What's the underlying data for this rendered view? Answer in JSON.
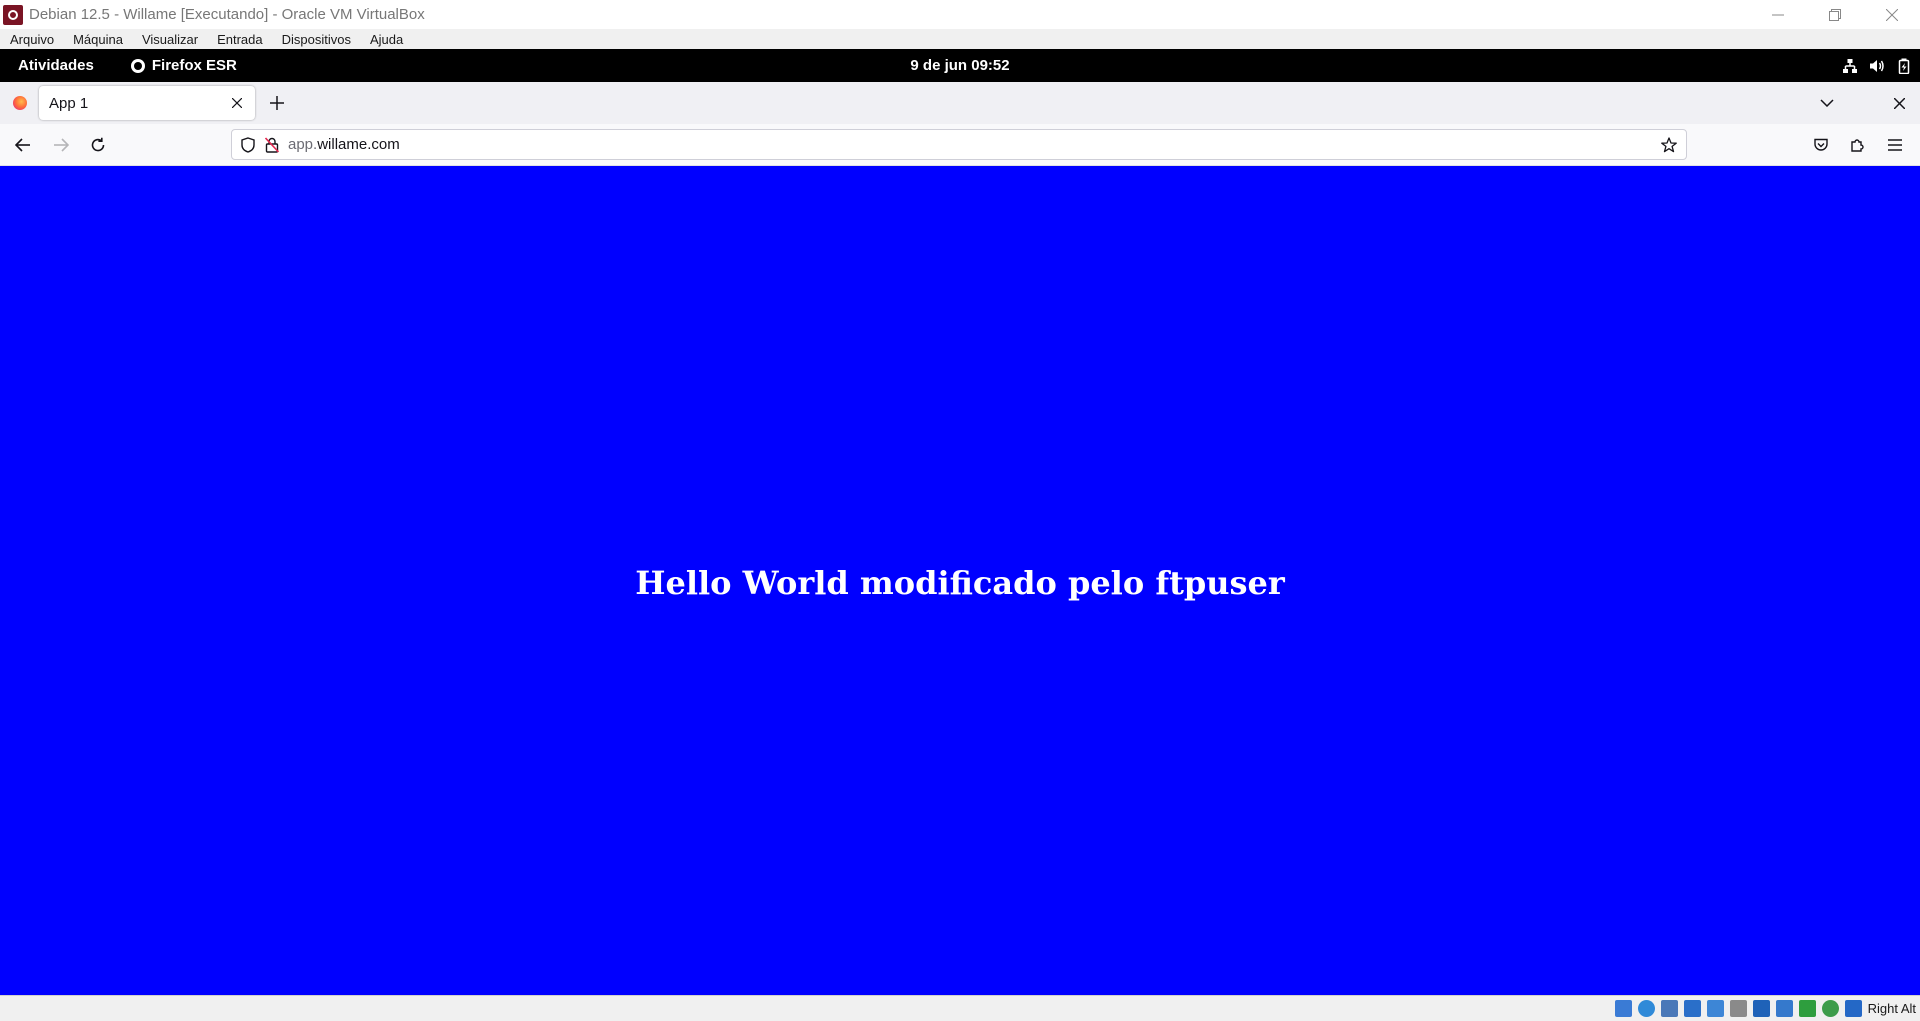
{
  "vbox": {
    "window_title": "Debian 12.5 - Willame [Executando] - Oracle VM VirtualBox",
    "menu": [
      "Arquivo",
      "Máquina",
      "Visualizar",
      "Entrada",
      "Dispositivos",
      "Ajuda"
    ],
    "host_key": "Right Alt",
    "status_icons": [
      "hard-disk-icon",
      "optical-drive-icon",
      "audio-icon",
      "network-icon",
      "usb-icon",
      "shared-folders-icon",
      "display-icon",
      "video-capture-icon",
      "cpu-activity-icon",
      "mouse-integration-icon",
      "keyboard-capture-icon"
    ],
    "accent": "#0000ff"
  },
  "gnome": {
    "activities": "Atividades",
    "app_name": "Firefox ESR",
    "clock": "9 de jun  09:52",
    "tray_icons": [
      "network-wired-icon",
      "volume-icon",
      "battery-icon"
    ]
  },
  "firefox": {
    "tab": {
      "title": "App 1"
    },
    "url": {
      "prefix": "app.",
      "domain": "willame.com"
    }
  },
  "page": {
    "heading": "Hello World modificado pelo ftpuser",
    "background": "#0000ff",
    "text_color": "#ffffff"
  }
}
